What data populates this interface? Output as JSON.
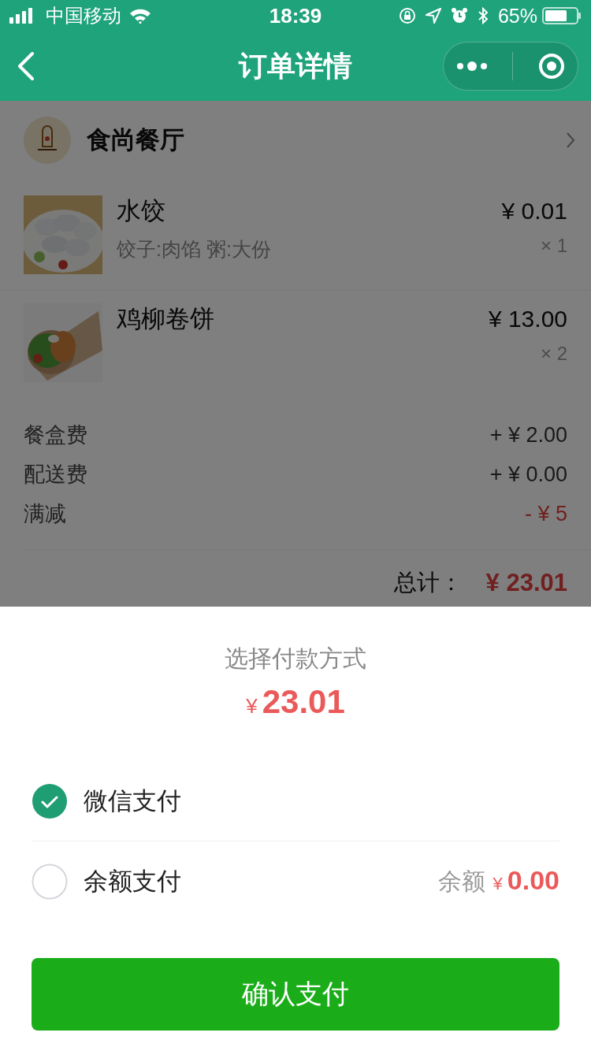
{
  "status_bar": {
    "carrier": "中国移动",
    "time": "18:39",
    "battery": "65%"
  },
  "nav": {
    "title": "订单详情"
  },
  "restaurant": {
    "name": "食尚餐厅"
  },
  "items": [
    {
      "name": "水饺",
      "options": "饺子:肉馅 粥:大份",
      "price": "¥ 0.01",
      "quantity": "× 1"
    },
    {
      "name": "鸡柳卷饼",
      "price": "¥ 13.00",
      "quantity": "× 2"
    }
  ],
  "fees": [
    {
      "label": "餐盒费",
      "amount": "+ ¥ 2.00",
      "kind": "charge"
    },
    {
      "label": "配送费",
      "amount": "+ ¥ 0.00",
      "kind": "charge"
    },
    {
      "label": "满减",
      "amount": "- ¥ 5",
      "kind": "discount"
    }
  ],
  "total": {
    "label": "总计：",
    "amount": "¥ 23.01"
  },
  "payment_sheet": {
    "title": "选择付款方式",
    "currency": "¥",
    "amount": "23.01",
    "methods": [
      {
        "label": "微信支付",
        "selected": true
      },
      {
        "label": "余额支付",
        "selected": false,
        "balance_label": "余额",
        "balance_currency": "¥",
        "balance_amount": "0.00"
      }
    ],
    "confirm_button": "确认支付"
  }
}
